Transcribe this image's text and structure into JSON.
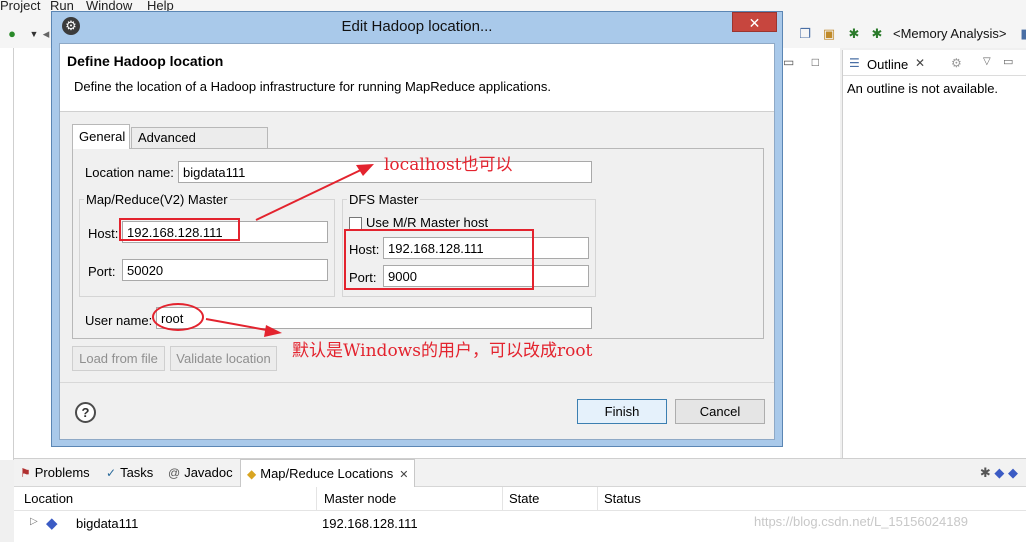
{
  "menubar": {
    "items": [
      "Project",
      "Run",
      "Window",
      "Help"
    ]
  },
  "toolbar": {
    "memory_analysis": "<Memory Analysis>"
  },
  "outline": {
    "tab_label": "Outline",
    "message": "An outline is not available."
  },
  "dialog": {
    "title": "Edit Hadoop location...",
    "close_symbol": "✕",
    "header_title": "Define Hadoop location",
    "header_desc": "Define the location of a Hadoop infrastructure for running MapReduce applications.",
    "tabs": {
      "general": "General",
      "advanced": "Advanced parameters"
    },
    "location_name_label": "Location name:",
    "location_name_value": "bigdata111",
    "mr_group": "Map/Reduce(V2) Master",
    "mr_host_label": "Host:",
    "mr_host_value": "192.168.128.111",
    "mr_port_label": "Port:",
    "mr_port_value": "50020",
    "dfs_group": "DFS Master",
    "use_mr_master": "Use M/R Master host",
    "dfs_host_label": "Host:",
    "dfs_host_value": "192.168.128.111",
    "dfs_port_label": "Port:",
    "dfs_port_value": "9000",
    "user_name_label": "User name:",
    "user_name_value": "root",
    "load_from_file": "Load from file",
    "validate_location": "Validate location",
    "help_symbol": "?",
    "finish": "Finish",
    "cancel": "Cancel"
  },
  "annotations": {
    "localhost_note": "localhost也可以",
    "user_note": "默认是Windows的用户，可以改成root",
    "color": "#e3232e"
  },
  "bottom": {
    "tabs": [
      "Problems",
      "Tasks",
      "Javadoc",
      "Map/Reduce Locations"
    ],
    "columns": [
      "Location",
      "Master node",
      "State",
      "Status"
    ],
    "rows": [
      {
        "location": "bigdata111",
        "master_node": "192.168.128.111"
      }
    ]
  },
  "watermark": "https://blog.csdn.net/L_15156024189"
}
